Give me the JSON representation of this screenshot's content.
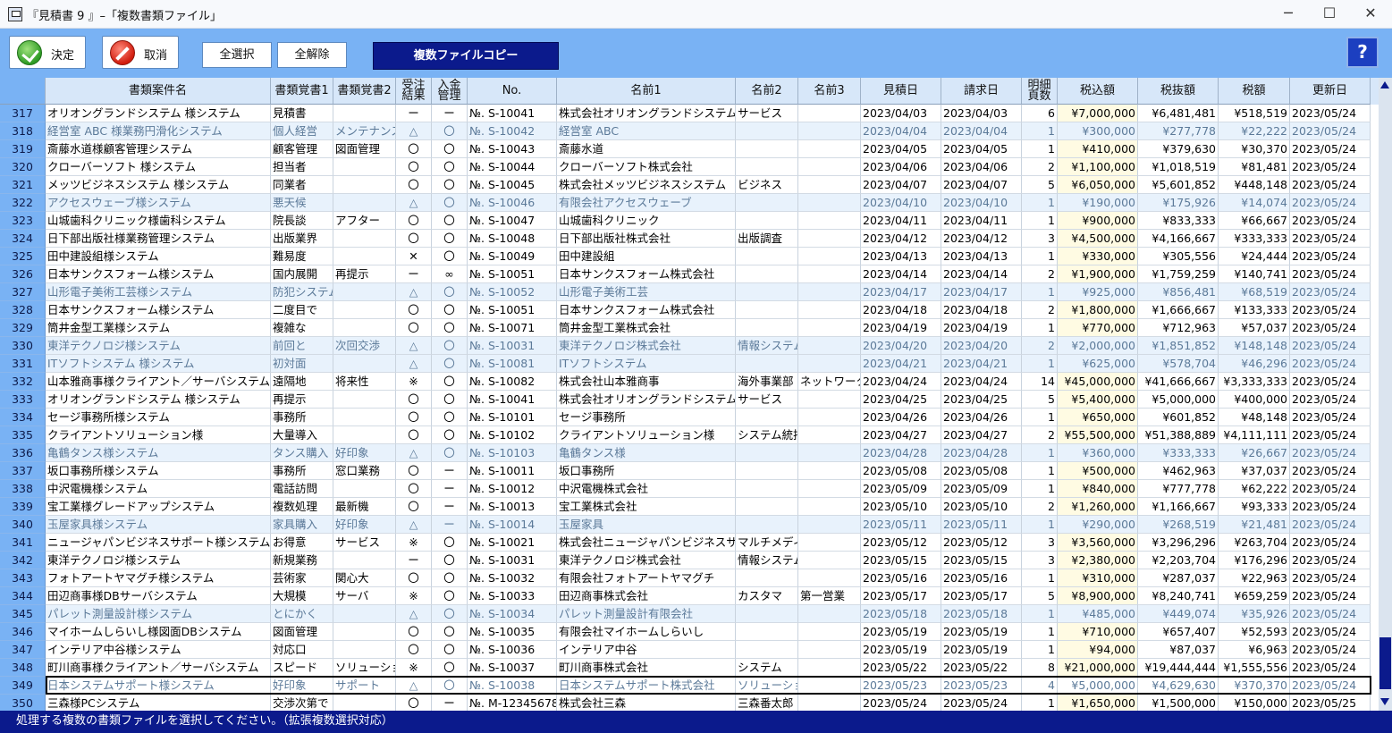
{
  "window": {
    "title": "『見積書 9 』–「複数書類ファイル」",
    "minimize_glyph": "─",
    "maximize_glyph": "☐",
    "close_glyph": "✕",
    "icon": "app-icon"
  },
  "toolbar": {
    "ok_label": "決定",
    "cancel_label": "取消",
    "select_all_label": "全選択",
    "deselect_all_label": "全解除",
    "copy_label": "複数ファイルコピー",
    "help_label": "?",
    "accent": "#0b1a8c",
    "toolbar_bg": "#79b2f4"
  },
  "table": {
    "headers": [
      "",
      "書類案件名",
      "書類覚書1",
      "書類覚書2",
      "受注\n結果",
      "入金\n管理",
      "No.",
      "名前1",
      "名前2",
      "名前3",
      "見積日",
      "請求日",
      "明細\n頁数",
      "税込額",
      "税抜額",
      "税額",
      "更新日"
    ],
    "rows": [
      [
        "317",
        "オリオングランドシステム 様システム",
        "見積書",
        "",
        "ー",
        "ー",
        "№. S-10041",
        "株式会社オリオングランドシステム",
        "サービス",
        "",
        "2023/04/03",
        "2023/04/03",
        "6",
        "¥7,000,000",
        "¥6,481,481",
        "¥518,519",
        "2023/05/24"
      ],
      [
        "318",
        "経営室 ABC 様業務円滑化システム",
        "個人経営",
        "メンテナンス",
        "△",
        "〇",
        "№. S-10042",
        "経営室 ABC",
        "",
        "",
        "2023/04/04",
        "2023/04/04",
        "1",
        "¥300,000",
        "¥277,778",
        "¥22,222",
        "2023/05/24"
      ],
      [
        "319",
        "斎藤水道様顧客管理システム",
        "顧客管理",
        "図面管理",
        "〇",
        "〇",
        "№. S-10043",
        "斎藤水道",
        "",
        "",
        "2023/04/05",
        "2023/04/05",
        "1",
        "¥410,000",
        "¥379,630",
        "¥30,370",
        "2023/05/24"
      ],
      [
        "320",
        "クローバーソフト 様システム",
        "担当者",
        "",
        "〇",
        "〇",
        "№. S-10044",
        "クローバーソフト株式会社",
        "",
        "",
        "2023/04/06",
        "2023/04/06",
        "2",
        "¥1,100,000",
        "¥1,018,519",
        "¥81,481",
        "2023/05/24"
      ],
      [
        "321",
        "メッツビジネスシステム 様システム",
        "同業者",
        "",
        "〇",
        "〇",
        "№. S-10045",
        "株式会社メッツビジネスシステム",
        "ビジネス",
        "",
        "2023/04/07",
        "2023/04/07",
        "5",
        "¥6,050,000",
        "¥5,601,852",
        "¥448,148",
        "2023/05/24"
      ],
      [
        "322",
        "アクセスウェーブ様システム",
        "悪天候",
        "",
        "△",
        "〇",
        "№. S-10046",
        "有限会社アクセスウェーブ",
        "",
        "",
        "2023/04/10",
        "2023/04/10",
        "1",
        "¥190,000",
        "¥175,926",
        "¥14,074",
        "2023/05/24"
      ],
      [
        "323",
        "山城歯科クリニック様歯科システム",
        "院長談",
        "アフター",
        "〇",
        "〇",
        "№. S-10047",
        "山城歯科クリニック",
        "",
        "",
        "2023/04/11",
        "2023/04/11",
        "1",
        "¥900,000",
        "¥833,333",
        "¥66,667",
        "2023/05/24"
      ],
      [
        "324",
        "日下部出版社様業務管理システム",
        "出版業界",
        "",
        "〇",
        "〇",
        "№. S-10048",
        "日下部出版社株式会社",
        "出版調査",
        "",
        "2023/04/12",
        "2023/04/12",
        "3",
        "¥4,500,000",
        "¥4,166,667",
        "¥333,333",
        "2023/05/24"
      ],
      [
        "325",
        "田中建設組様システム",
        "難易度",
        "",
        "✕",
        "〇",
        "№. S-10049",
        "田中建設組",
        "",
        "",
        "2023/04/13",
        "2023/04/13",
        "1",
        "¥330,000",
        "¥305,556",
        "¥24,444",
        "2023/05/24"
      ],
      [
        "326",
        "日本サンクスフォーム様システム",
        "国内展開",
        "再提示",
        "ー",
        "∞",
        "№. S-10051",
        "日本サンクスフォーム株式会社",
        "",
        "",
        "2023/04/14",
        "2023/04/14",
        "2",
        "¥1,900,000",
        "¥1,759,259",
        "¥140,741",
        "2023/05/24"
      ],
      [
        "327",
        "山形電子美術工芸様システム",
        "防犯システム",
        "",
        "△",
        "〇",
        "№. S-10052",
        "山形電子美術工芸",
        "",
        "",
        "2023/04/17",
        "2023/04/17",
        "1",
        "¥925,000",
        "¥856,481",
        "¥68,519",
        "2023/05/24"
      ],
      [
        "328",
        "日本サンクスフォーム様システム",
        "二度目で",
        "",
        "〇",
        "〇",
        "№. S-10051",
        "日本サンクスフォーム株式会社",
        "",
        "",
        "2023/04/18",
        "2023/04/18",
        "2",
        "¥1,800,000",
        "¥1,666,667",
        "¥133,333",
        "2023/05/24"
      ],
      [
        "329",
        "筒井金型工業様システム",
        "複雑な",
        "",
        "〇",
        "〇",
        "№. S-10071",
        "筒井金型工業株式会社",
        "",
        "",
        "2023/04/19",
        "2023/04/19",
        "1",
        "¥770,000",
        "¥712,963",
        "¥57,037",
        "2023/05/24"
      ],
      [
        "330",
        "東洋テクノロジ様システム",
        "前回と",
        "次回交渉",
        "△",
        "〇",
        "№. S-10031",
        "東洋テクノロジ株式会社",
        "情報システム",
        "",
        "2023/04/20",
        "2023/04/20",
        "2",
        "¥2,000,000",
        "¥1,851,852",
        "¥148,148",
        "2023/05/24"
      ],
      [
        "331",
        "ITソフトシステム 様システム",
        "初対面",
        "",
        "△",
        "〇",
        "№. S-10081",
        "ITソフトシステム",
        "",
        "",
        "2023/04/21",
        "2023/04/21",
        "1",
        "¥625,000",
        "¥578,704",
        "¥46,296",
        "2023/05/24"
      ],
      [
        "332",
        "山本雅商事様クライアント／サーバシステム",
        "遠隔地",
        "将来性",
        "※",
        "〇",
        "№. S-10082",
        "株式会社山本雅商事",
        "海外事業部",
        "ネットワーク",
        "2023/04/24",
        "2023/04/24",
        "14",
        "¥45,000,000",
        "¥41,666,667",
        "¥3,333,333",
        "2023/05/24"
      ],
      [
        "333",
        "オリオングランドシステム 様システム",
        "再提示",
        "",
        "〇",
        "〇",
        "№. S-10041",
        "株式会社オリオングランドシステム",
        "サービス",
        "",
        "2023/04/25",
        "2023/04/25",
        "5",
        "¥5,400,000",
        "¥5,000,000",
        "¥400,000",
        "2023/05/24"
      ],
      [
        "334",
        "セージ事務所様システム",
        "事務所",
        "",
        "〇",
        "〇",
        "№. S-10101",
        "セージ事務所",
        "",
        "",
        "2023/04/26",
        "2023/04/26",
        "1",
        "¥650,000",
        "¥601,852",
        "¥48,148",
        "2023/05/24"
      ],
      [
        "335",
        "クライアントソリューション様",
        "大量導入",
        "",
        "〇",
        "〇",
        "№. S-10102",
        "クライアントソリューション様",
        "システム統括",
        "",
        "2023/04/27",
        "2023/04/27",
        "2",
        "¥55,500,000",
        "¥51,388,889",
        "¥4,111,111",
        "2023/05/24"
      ],
      [
        "336",
        "亀鶴タンス様システム",
        "タンス購入",
        "好印象",
        "△",
        "〇",
        "№. S-10103",
        "亀鶴タンス様",
        "",
        "",
        "2023/04/28",
        "2023/04/28",
        "1",
        "¥360,000",
        "¥333,333",
        "¥26,667",
        "2023/05/24"
      ],
      [
        "337",
        "坂口事務所様システム",
        "事務所",
        "窓口業務",
        "〇",
        "ー",
        "№. S-10011",
        "坂口事務所",
        "",
        "",
        "2023/05/08",
        "2023/05/08",
        "1",
        "¥500,000",
        "¥462,963",
        "¥37,037",
        "2023/05/24"
      ],
      [
        "338",
        "中沢電機様システム",
        "電話訪問",
        "",
        "〇",
        "ー",
        "№. S-10012",
        "中沢電機株式会社",
        "",
        "",
        "2023/05/09",
        "2023/05/09",
        "1",
        "¥840,000",
        "¥777,778",
        "¥62,222",
        "2023/05/24"
      ],
      [
        "339",
        "宝工業様グレードアップシステム",
        "複数処理",
        "最新機",
        "〇",
        "ー",
        "№. S-10013",
        "宝工業株式会社",
        "",
        "",
        "2023/05/10",
        "2023/05/10",
        "2",
        "¥1,260,000",
        "¥1,166,667",
        "¥93,333",
        "2023/05/24"
      ],
      [
        "340",
        "玉屋家具様システム",
        "家具購入",
        "好印象",
        "△",
        "ー",
        "№. S-10014",
        "玉屋家具",
        "",
        "",
        "2023/05/11",
        "2023/05/11",
        "1",
        "¥290,000",
        "¥268,519",
        "¥21,481",
        "2023/05/24"
      ],
      [
        "341",
        "ニュージャパンビジネスサポート様システム",
        "お得意",
        "サービス",
        "※",
        "〇",
        "№. S-10021",
        "株式会社ニュージャパンビジネスサポート",
        "マルチメディア",
        "",
        "2023/05/12",
        "2023/05/12",
        "3",
        "¥3,560,000",
        "¥3,296,296",
        "¥263,704",
        "2023/05/24"
      ],
      [
        "342",
        "東洋テクノロジ様システム",
        "新規業務",
        "",
        "ー",
        "〇",
        "№. S-10031",
        "東洋テクノロジ株式会社",
        "情報システム",
        "",
        "2023/05/15",
        "2023/05/15",
        "3",
        "¥2,380,000",
        "¥2,203,704",
        "¥176,296",
        "2023/05/24"
      ],
      [
        "343",
        "フォトアートヤマグチ様システム",
        "芸術家",
        "関心大",
        "〇",
        "〇",
        "№. S-10032",
        "有限会社フォトアートヤマグチ",
        "",
        "",
        "2023/05/16",
        "2023/05/16",
        "1",
        "¥310,000",
        "¥287,037",
        "¥22,963",
        "2023/05/24"
      ],
      [
        "344",
        "田辺商事様DBサーバシステム",
        "大規模",
        "サーバ",
        "※",
        "〇",
        "№. S-10033",
        "田辺商事株式会社",
        "カスタマ",
        "第一営業",
        "2023/05/17",
        "2023/05/17",
        "5",
        "¥8,900,000",
        "¥8,240,741",
        "¥659,259",
        "2023/05/24"
      ],
      [
        "345",
        "パレット測量設計様システム",
        "とにかく",
        "",
        "△",
        "〇",
        "№. S-10034",
        "パレット測量設計有限会社",
        "",
        "",
        "2023/05/18",
        "2023/05/18",
        "1",
        "¥485,000",
        "¥449,074",
        "¥35,926",
        "2023/05/24"
      ],
      [
        "346",
        "マイホームしらいし様図面DBシステム",
        "図面管理",
        "",
        "〇",
        "〇",
        "№. S-10035",
        "有限会社マイホームしらいし",
        "",
        "",
        "2023/05/19",
        "2023/05/19",
        "1",
        "¥710,000",
        "¥657,407",
        "¥52,593",
        "2023/05/24"
      ],
      [
        "347",
        "インテリア中谷様システム",
        "対応口",
        "",
        "〇",
        "〇",
        "№. S-10036",
        "インテリア中谷",
        "",
        "",
        "2023/05/19",
        "2023/05/19",
        "1",
        "¥94,000",
        "¥87,037",
        "¥6,963",
        "2023/05/24"
      ],
      [
        "348",
        "町川商事様クライアント／サーバシステム",
        "スピード",
        "ソリューション",
        "※",
        "〇",
        "№. S-10037",
        "町川商事株式会社",
        "システム",
        "",
        "2023/05/22",
        "2023/05/22",
        "8",
        "¥21,000,000",
        "¥19,444,444",
        "¥1,555,556",
        "2023/05/24"
      ],
      [
        "349",
        "日本システムサポート様システム",
        "好印象",
        "サポート",
        "△",
        "〇",
        "№. S-10038",
        "日本システムサポート株式会社",
        "ソリューション",
        "",
        "2023/05/23",
        "2023/05/23",
        "4",
        "¥5,000,000",
        "¥4,629,630",
        "¥370,370",
        "2023/05/24"
      ],
      [
        "350",
        "三森様PCシステム",
        "交渉次第で",
        "",
        "〇",
        "ー",
        "№. M-123456789",
        "株式会社三森",
        "三森番太郎",
        "",
        "2023/05/24",
        "2023/05/24",
        "1",
        "¥1,650,000",
        "¥1,500,000",
        "¥150,000",
        "2023/05/25"
      ]
    ],
    "alt_rows": [
      "318",
      "322",
      "327",
      "330",
      "331",
      "336",
      "340",
      "345"
    ],
    "selected_row": "349"
  },
  "status": {
    "message": "処理する複数の書類ファイルを選択してください。（拡張複数選択対応）"
  }
}
